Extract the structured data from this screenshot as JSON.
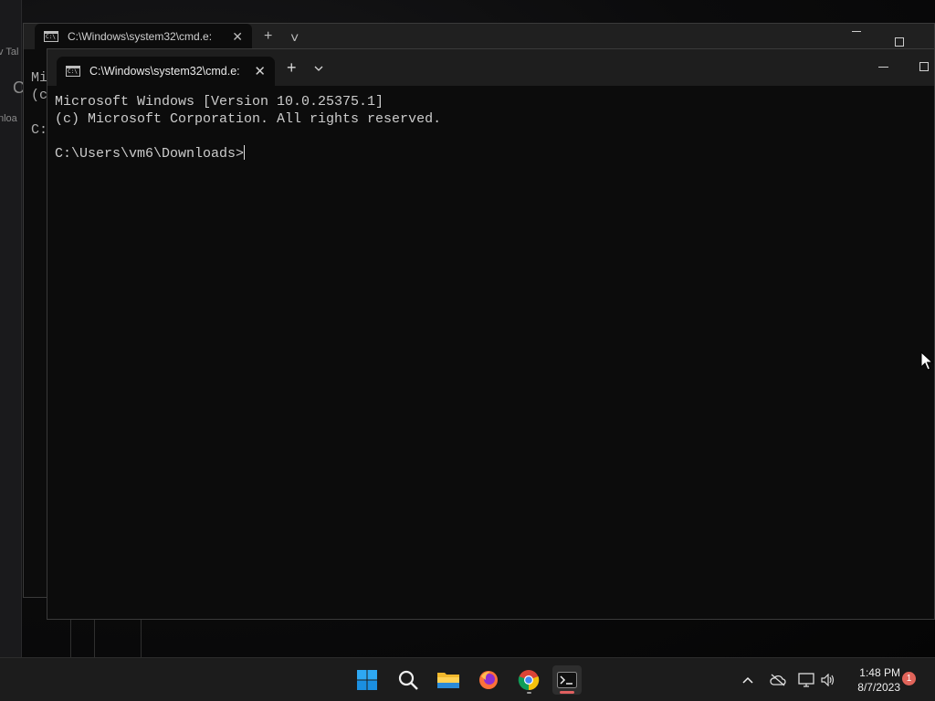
{
  "background_window": {
    "tab_title": "C:\\Windows\\system32\\cmd.e:",
    "lines": [
      "Mi",
      "(c",
      "",
      "C:"
    ]
  },
  "desktop_fragments": {
    "left_label_1": "v Tal",
    "left_label_2": "nloa",
    "left_glyph": "C"
  },
  "terminal": {
    "tab_title": "C:\\Windows\\system32\\cmd.e:",
    "new_tab_label": "+",
    "dropdown_label": "˅",
    "lines": [
      "Microsoft Windows [Version 10.0.25375.1]",
      "(c) Microsoft Corporation. All rights reserved.",
      "",
      "C:\\Users\\vm6\\Downloads>"
    ]
  },
  "taskbar": {
    "apps": [
      {
        "name": "start",
        "icon": "windows-logo-icon"
      },
      {
        "name": "search",
        "icon": "search-icon"
      },
      {
        "name": "file-explorer",
        "icon": "folder-icon"
      },
      {
        "name": "firefox",
        "icon": "firefox-icon"
      },
      {
        "name": "chrome",
        "icon": "chrome-icon"
      },
      {
        "name": "terminal",
        "icon": "terminal-icon",
        "active": true
      }
    ],
    "clock_time": "1:48 PM",
    "clock_date": "8/7/2023",
    "notification_count": "1"
  },
  "colors": {
    "accent": "#e06060",
    "terminal_bg": "#0c0c0c",
    "taskbar_bg": "#1c1c1c"
  }
}
